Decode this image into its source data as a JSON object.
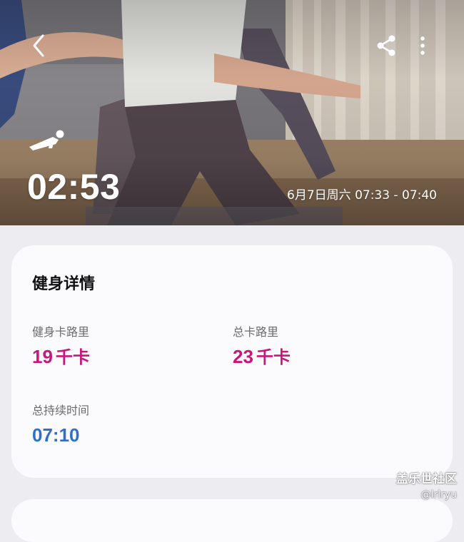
{
  "header": {
    "back_icon": "back-arrow-icon",
    "share_icon": "share-icon",
    "more_icon": "more-vertical-icon",
    "workout_type_icon": "plank-workout-icon",
    "duration": "02:53",
    "time_range": "6月7日周六 07:33 - 07:40"
  },
  "details": {
    "title": "健身详情",
    "workout_calories": {
      "label": "健身卡路里",
      "value": "19",
      "unit": "千卡"
    },
    "total_calories": {
      "label": "总卡路里",
      "value": "23",
      "unit": "千卡"
    },
    "total_duration": {
      "label": "总持续时间",
      "value": "07:10"
    }
  },
  "watermark": {
    "title": "盖乐世社区",
    "user": "@lrlryu"
  },
  "colors": {
    "calorie_accent": "#c8177a",
    "duration_accent": "#2f6fc7",
    "card_bg": "#fbfbfe",
    "page_bg": "#ececf1"
  }
}
